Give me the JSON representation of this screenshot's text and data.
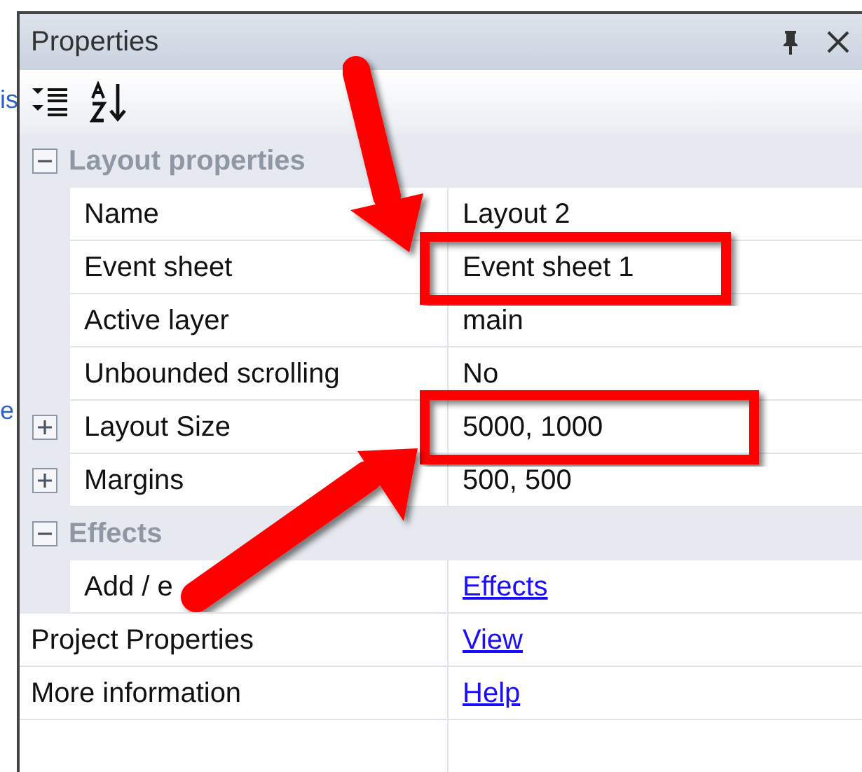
{
  "background_fragments": [
    "is",
    "e"
  ],
  "window": {
    "title": "Properties"
  },
  "toolbar": [
    {
      "kind": "categorized"
    },
    {
      "kind": "alphabetical"
    }
  ],
  "groups": [
    {
      "label": "Layout properties",
      "expanded": true,
      "rows": [
        {
          "name": "Name",
          "value": "Layout 2",
          "kind": "text"
        },
        {
          "name": "Event sheet",
          "value": "Event sheet 1",
          "kind": "text"
        },
        {
          "name": "Active layer",
          "value": "main",
          "kind": "text"
        },
        {
          "name": "Unbounded scrolling",
          "value": "No",
          "kind": "text"
        },
        {
          "name": "Layout Size",
          "value": "5000, 1000",
          "kind": "text",
          "expanded": false
        },
        {
          "name": "Margins",
          "value": "500, 500",
          "kind": "text",
          "expanded": false
        }
      ]
    },
    {
      "label": "Effects",
      "expanded": true,
      "rows": [
        {
          "name": "Add / e",
          "value": "Effects",
          "kind": "link"
        }
      ]
    }
  ],
  "footer_rows": [
    {
      "name": "Project Properties",
      "value": "View",
      "kind": "link"
    },
    {
      "name": "More information",
      "value": "Help",
      "kind": "link"
    }
  ]
}
